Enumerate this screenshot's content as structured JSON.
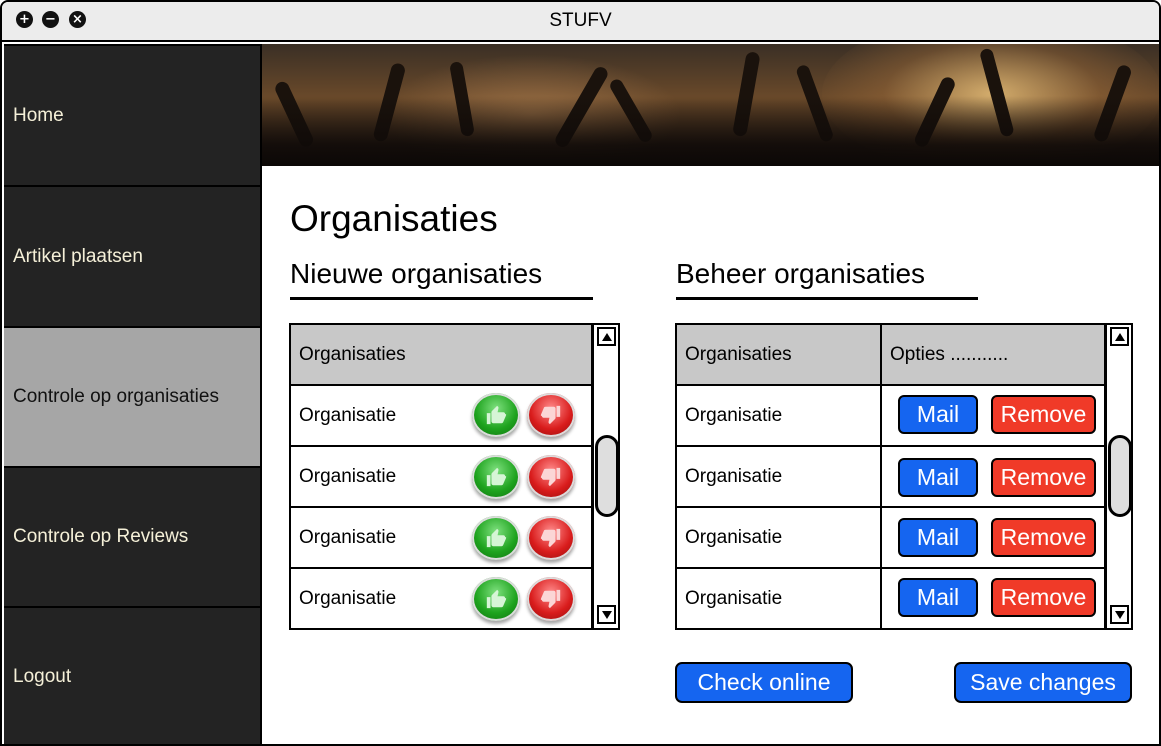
{
  "window": {
    "title": "STUFV"
  },
  "window_controls": [
    "plus-icon",
    "minus-icon",
    "close-icon"
  ],
  "sidebar": {
    "items": [
      {
        "label": "Home",
        "active": false
      },
      {
        "label": "Artikel plaatsen",
        "active": false
      },
      {
        "label": "Controle op organisaties",
        "active": true
      },
      {
        "label": "Controle op Reviews",
        "active": false
      },
      {
        "label": "Logout",
        "active": false
      }
    ]
  },
  "main": {
    "title": "Organisaties",
    "new_section": {
      "title": "Nieuwe organisaties",
      "header": "Organisaties",
      "rows": [
        "Organisatie",
        "Organisatie",
        "Organisatie",
        "Organisatie"
      ]
    },
    "manage_section": {
      "title": "Beheer organisaties",
      "headers": [
        "Organisaties",
        "Opties ..........."
      ],
      "rows": [
        "Organisatie",
        "Organisatie",
        "Organisatie",
        "Organisatie"
      ],
      "mail_label": "Mail",
      "remove_label": "Remove"
    },
    "check_online_label": "Check online",
    "save_changes_label": "Save changes"
  },
  "colors": {
    "sidebar_bg": "#232323",
    "sidebar_active": "#a6a6a6",
    "sidebar_text": "#f5f0d8",
    "primary_button": "#1565f0",
    "danger_button": "#f03a28",
    "table_header": "#c8c8c8"
  }
}
